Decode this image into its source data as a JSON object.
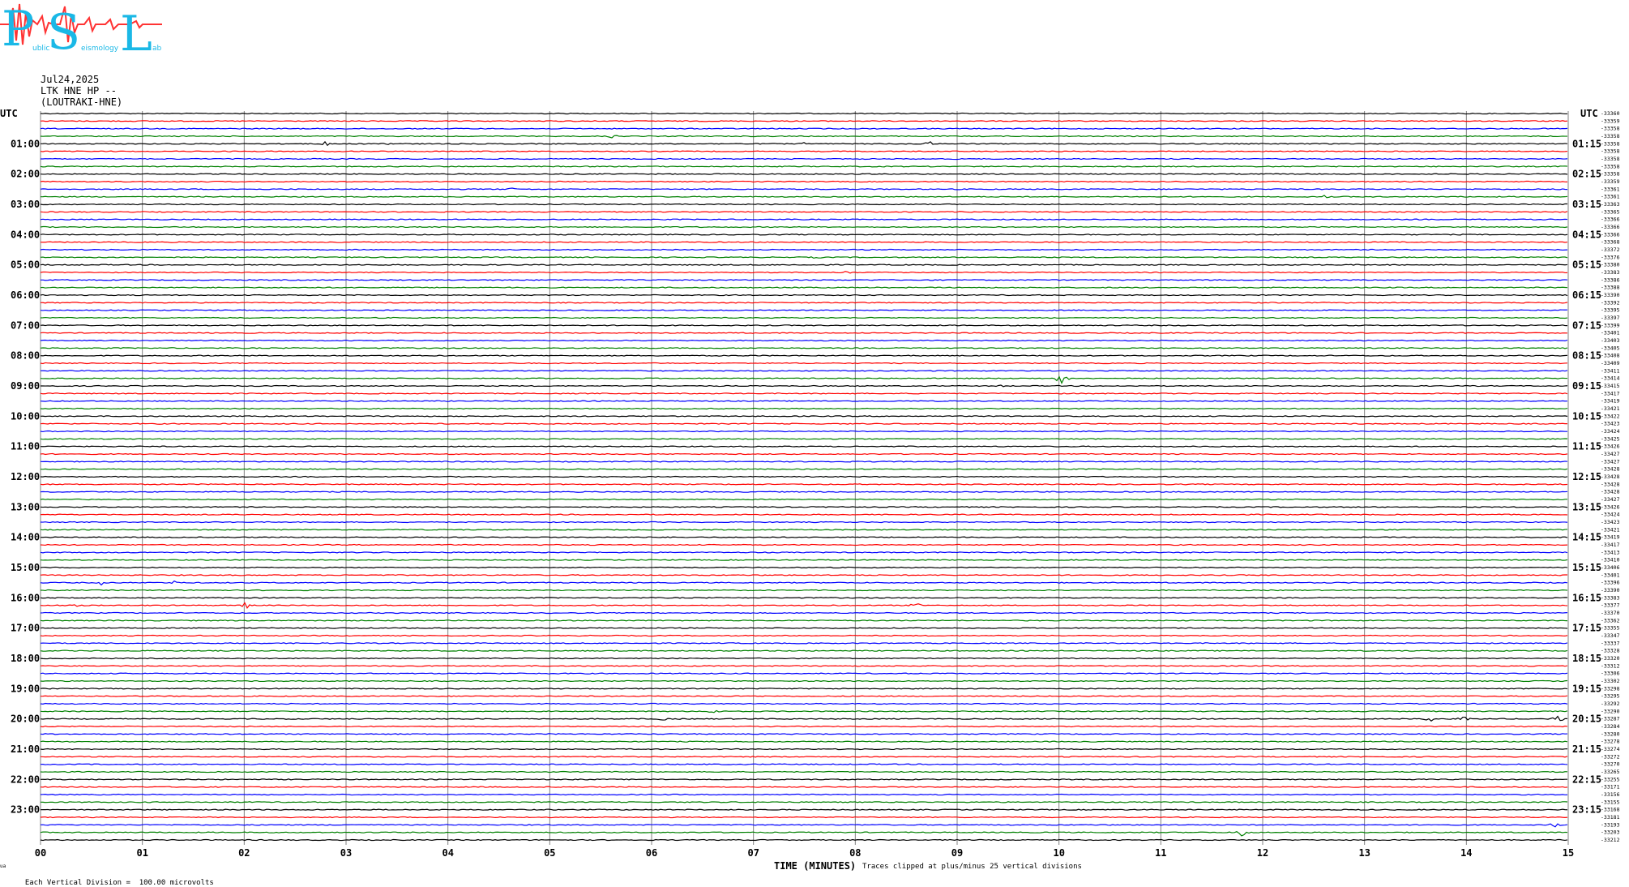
{
  "logo": {
    "letters": [
      "P",
      "S",
      "L"
    ],
    "small_words": [
      "ublic",
      "eismology",
      "ab"
    ],
    "colors": {
      "letters": "#1ab8e6",
      "waveform": "#ff3333"
    }
  },
  "header": {
    "date": "Jul24,2025",
    "station": "LTK HNE HP --",
    "location": "(LOUTRAKI-HNE)"
  },
  "axes": {
    "left_label": "UTC",
    "right_label": "UTC",
    "x_label": "TIME (MINUTES)",
    "vertical_division_note": "Each Vertical Division =  100.00 microvolts",
    "clip_note": "Traces clipped at plus/minus 25 vertical divisions",
    "corner_mark": "ua"
  },
  "chart_data": {
    "type": "line",
    "title": "LTK HNE HP -- (LOUTRAKI-HNE)",
    "date": "Jul24,2025",
    "xlabel": "TIME (MINUTES)",
    "xlim": [
      0,
      15
    ],
    "x_ticks": [
      "00",
      "01",
      "02",
      "03",
      "04",
      "05",
      "06",
      "07",
      "08",
      "09",
      "10",
      "11",
      "12",
      "13",
      "14",
      "15"
    ],
    "left_hour_labels": [
      "01:00",
      "02:00",
      "03:00",
      "04:00",
      "05:00",
      "06:00",
      "07:00",
      "08:00",
      "09:00",
      "10:00",
      "11:00",
      "12:00",
      "13:00",
      "14:00",
      "15:00",
      "16:00",
      "17:00",
      "18:00",
      "19:00",
      "20:00",
      "21:00",
      "22:00",
      "23:00"
    ],
    "right_hour_labels": [
      "01:15",
      "02:15",
      "03:15",
      "04:15",
      "05:15",
      "06:15",
      "07:15",
      "08:15",
      "09:15",
      "10:15",
      "11:15",
      "12:15",
      "13:15",
      "14:15",
      "15:15",
      "16:15",
      "17:15",
      "18:15",
      "19:15",
      "20:15",
      "21:15",
      "22:15",
      "23:15"
    ],
    "trace_colors": [
      "#000000",
      "#ff0000",
      "#0000ff",
      "#008000"
    ],
    "trace_offsets": [
      "-33360",
      "-33359",
      "-33358",
      "-33358",
      "-33358",
      "-33358",
      "-33358",
      "-33358",
      "-33358",
      "-33359",
      "-33361",
      "-33361",
      "-33363",
      "-33365",
      "-33366",
      "-33366",
      "-33366",
      "-33368",
      "-33372",
      "-33376",
      "-33380",
      "-33383",
      "-33386",
      "-33388",
      "-33390",
      "-33392",
      "-33395",
      "-33397",
      "-33399",
      "-33401",
      "-33403",
      "-33405",
      "-33408",
      "-33409",
      "-33411",
      "-33414",
      "-33415",
      "-33417",
      "-33419",
      "-33421",
      "-33422",
      "-33423",
      "-33424",
      "-33425",
      "-33426",
      "-33427",
      "-33427",
      "-33428",
      "-33428",
      "-33428",
      "-33428",
      "-33427",
      "-33426",
      "-33424",
      "-33423",
      "-33421",
      "-33419",
      "-33417",
      "-33413",
      "-33410",
      "-33406",
      "-33401",
      "-33396",
      "-33390",
      "-33383",
      "-33377",
      "-33370",
      "-33362",
      "-33355",
      "-33347",
      "-33337",
      "-33328",
      "-33320",
      "-33312",
      "-33306",
      "-33302",
      "-33298",
      "-33295",
      "-33292",
      "-33290",
      "-33287",
      "-33284",
      "-33280",
      "-33278",
      "-33274",
      "-33272",
      "-33270",
      "-33265",
      "-33255",
      "-33171",
      "-33156",
      "-33155",
      "-33168",
      "-33181",
      "-33193",
      "-33203",
      "-33212"
    ],
    "events": [
      {
        "trace": 4,
        "minute": 2.8,
        "amp": 3
      },
      {
        "trace": 4,
        "minute": 3.4,
        "amp": 3
      },
      {
        "trace": 4,
        "minute": 7.5,
        "amp": 2
      },
      {
        "trace": 4,
        "minute": 8.72,
        "amp": 5
      },
      {
        "trace": 3,
        "minute": 5.6,
        "amp": 2
      },
      {
        "trace": 10,
        "minute": 4.6,
        "amp": 2
      },
      {
        "trace": 11,
        "minute": 12.6,
        "amp": 2
      },
      {
        "trace": 19,
        "minute": 7.6,
        "amp": 2
      },
      {
        "trace": 20,
        "minute": 8.1,
        "amp": 2
      },
      {
        "trace": 21,
        "minute": 7.9,
        "amp": 2
      },
      {
        "trace": 35,
        "minute": 10.03,
        "amp": 8
      },
      {
        "trace": 36,
        "minute": 6.8,
        "amp": 2
      },
      {
        "trace": 36,
        "minute": 9.4,
        "amp": 2
      },
      {
        "trace": 62,
        "minute": 0.6,
        "amp": 3
      },
      {
        "trace": 62,
        "minute": 1.3,
        "amp": 3
      },
      {
        "trace": 65,
        "minute": 0.35,
        "amp": 3
      },
      {
        "trace": 65,
        "minute": 2.02,
        "amp": 4
      },
      {
        "trace": 65,
        "minute": 8.6,
        "amp": 3
      },
      {
        "trace": 79,
        "minute": 6.6,
        "amp": 3
      },
      {
        "trace": 80,
        "minute": 6.08,
        "amp": 3
      },
      {
        "trace": 80,
        "minute": 13.65,
        "amp": 4
      },
      {
        "trace": 80,
        "minute": 13.98,
        "amp": 3
      },
      {
        "trace": 80,
        "minute": 14.9,
        "amp": 4
      },
      {
        "trace": 94,
        "minute": 14.85,
        "amp": 3
      },
      {
        "trace": 95,
        "minute": 11.8,
        "amp": 5
      }
    ]
  }
}
